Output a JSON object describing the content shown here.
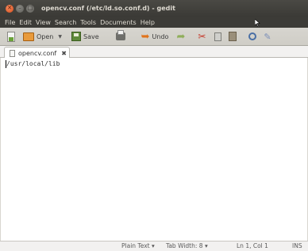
{
  "window": {
    "title": "opencv.conf (/etc/ld.so.conf.d) - gedit"
  },
  "menu": {
    "items": [
      "File",
      "Edit",
      "View",
      "Search",
      "Tools",
      "Documents",
      "Help"
    ]
  },
  "toolbar": {
    "open_label": "Open",
    "save_label": "Save",
    "undo_label": "Undo"
  },
  "tab": {
    "label": "opencv.conf"
  },
  "editor": {
    "lines": [
      "/usr/local/lib"
    ]
  },
  "statusbar": {
    "language": "Plain Text",
    "tab_width": "Tab Width: 8",
    "position": "Ln 1, Col 1",
    "mode": "INS"
  },
  "colors": {
    "titlebar": "#3c3b37",
    "close_button": "#e0561f",
    "editor_bg": "#ffffff"
  }
}
